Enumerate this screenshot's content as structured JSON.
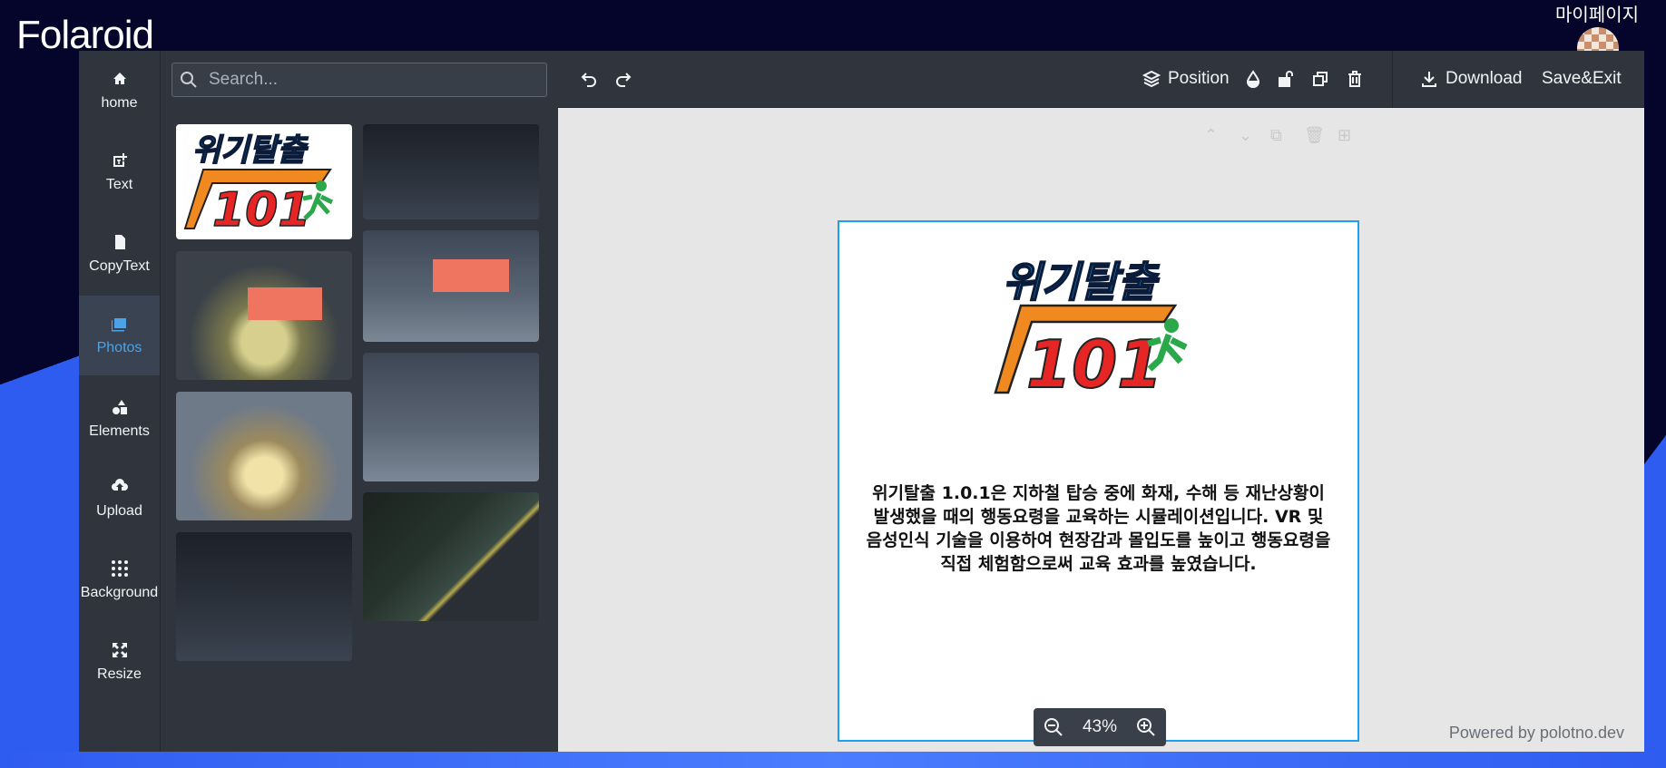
{
  "brand": {
    "name": "Folaroid"
  },
  "header": {
    "mypage_label": "마이페이지"
  },
  "rail": {
    "items": [
      {
        "label": "home",
        "icon": "home-icon"
      },
      {
        "label": "Text",
        "icon": "text-add-icon"
      },
      {
        "label": "CopyText",
        "icon": "document-icon"
      },
      {
        "label": "Photos",
        "icon": "image-icon",
        "active": true
      },
      {
        "label": "Elements",
        "icon": "shapes-icon"
      },
      {
        "label": "Upload",
        "icon": "cloud-upload-icon"
      },
      {
        "label": "Background",
        "icon": "dots-grid-icon"
      },
      {
        "label": "Resize",
        "icon": "resize-icon"
      }
    ]
  },
  "panel": {
    "search_placeholder": "Search...",
    "photos": [
      {
        "kind": "logo"
      },
      {
        "kind": "dark"
      },
      {
        "kind": "fire"
      },
      {
        "kind": "scene"
      },
      {
        "kind": "scene"
      },
      {
        "kind": "smoke"
      },
      {
        "kind": "sign"
      },
      {
        "kind": "dark"
      }
    ]
  },
  "toolbar": {
    "position_label": "Position",
    "download_label": "Download",
    "save_exit_label": "Save&Exit"
  },
  "canvas": {
    "logo_title": "위기탈출",
    "logo_number": "101",
    "description_lines": [
      "위기탈출 1.0.1은 지하철 탑승 중에 화재, 수해 등 재난상황이",
      "발생했을 때의 행동요령을 교육하는 시뮬레이션입니다. VR 및",
      "음성인식 기술을 이용하여 현장감과 몰입도를 높이고 행동요령을",
      "직접 체험함으로써 교육 효과를 높였습니다."
    ]
  },
  "zoom": {
    "value": "43%"
  },
  "footer": {
    "powered": "Powered by polotno.dev"
  },
  "colors": {
    "accent": "#1ba1f2",
    "active_nav": "#4aa3e8",
    "panel_bg": "#30353d"
  }
}
